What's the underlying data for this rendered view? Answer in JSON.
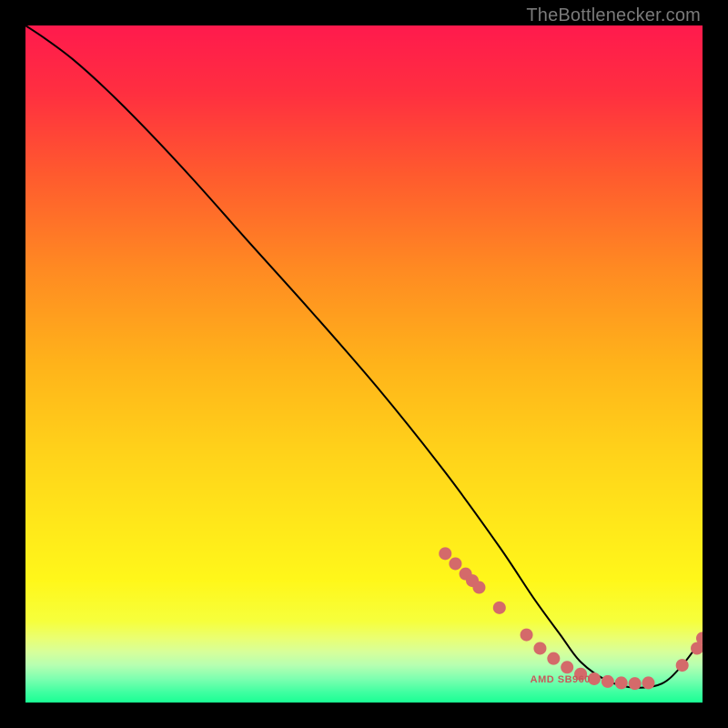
{
  "watermark": "TheBottlenecker.com",
  "chart_data": {
    "type": "line",
    "title": "",
    "xlabel": "",
    "ylabel": "",
    "xlim": [
      0,
      100
    ],
    "ylim": [
      0,
      100
    ],
    "grid": false,
    "legend": false,
    "annotations": [
      "AMD SB960"
    ],
    "series": [
      {
        "name": "curve",
        "x": [
          0,
          3,
          7,
          12,
          18,
          25,
          33,
          42,
          52,
          62,
          70,
          75,
          79,
          82,
          86,
          90,
          94,
          97,
          100
        ],
        "y": [
          100,
          98,
          95,
          90.5,
          84.5,
          77,
          68,
          58,
          46.5,
          34,
          23,
          15.5,
          10,
          6,
          3.2,
          2.2,
          2.8,
          5.5,
          9.5
        ]
      },
      {
        "name": "markers",
        "x": [
          62,
          63.5,
          65,
          66,
          67,
          70,
          74,
          76,
          78,
          80,
          82,
          84,
          86,
          88,
          90,
          92,
          97,
          99.2,
          100
        ],
        "y": [
          22,
          20.5,
          19,
          18,
          17,
          14,
          10,
          8,
          6.5,
          5.2,
          4.2,
          3.5,
          3.1,
          2.9,
          2.8,
          2.9,
          5.5,
          8,
          9.5
        ]
      }
    ],
    "background_gradient_stops": [
      {
        "offset": 0,
        "color": "#ff1a4d"
      },
      {
        "offset": 0.1,
        "color": "#ff2f40"
      },
      {
        "offset": 0.22,
        "color": "#ff5a2e"
      },
      {
        "offset": 0.36,
        "color": "#ff8a22"
      },
      {
        "offset": 0.5,
        "color": "#ffb31a"
      },
      {
        "offset": 0.63,
        "color": "#ffd21a"
      },
      {
        "offset": 0.74,
        "color": "#ffe81a"
      },
      {
        "offset": 0.82,
        "color": "#fff71a"
      },
      {
        "offset": 0.88,
        "color": "#f6ff3c"
      },
      {
        "offset": 0.905,
        "color": "#eaff72"
      },
      {
        "offset": 0.925,
        "color": "#d7ff9a"
      },
      {
        "offset": 0.945,
        "color": "#b6ffb1"
      },
      {
        "offset": 0.965,
        "color": "#7dffb0"
      },
      {
        "offset": 0.985,
        "color": "#3fffa1"
      },
      {
        "offset": 1.0,
        "color": "#1aff94"
      }
    ],
    "curve_color": "#000000",
    "marker_color": "#d46a6a",
    "marker_radius": 7
  }
}
